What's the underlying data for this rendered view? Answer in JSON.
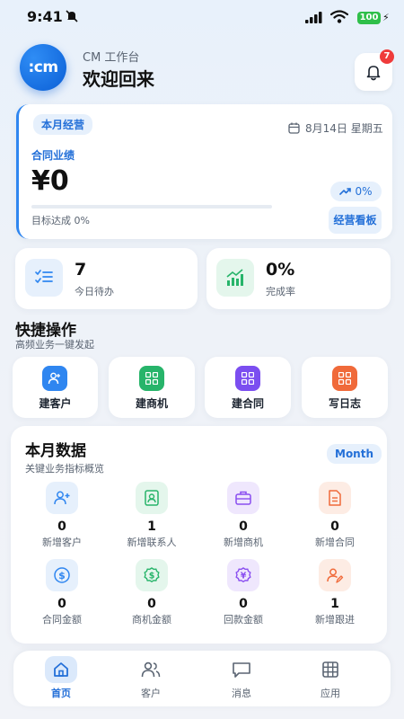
{
  "status_bar": {
    "time": "9:41",
    "battery": "100"
  },
  "header": {
    "logo_text": ":cm",
    "subtitle": "CM 工作台",
    "title": "欢迎回来",
    "notification_count": "7"
  },
  "overview": {
    "period_chip": "本月经营",
    "date": "8月14日 星期五",
    "metric_label": "合同业绩",
    "amount": "¥0",
    "target_text": "目标达成 0%",
    "progress_fraction": 0,
    "trend": "0%",
    "dashboard_button": "经营看板"
  },
  "stats": [
    {
      "value": "7",
      "label": "今日待办",
      "icon": "checklist-icon"
    },
    {
      "value": "0%",
      "label": "完成率",
      "icon": "growth-chart-icon"
    }
  ],
  "quick_actions": {
    "title": "快捷操作",
    "subtitle": "高频业务一键发起",
    "items": [
      {
        "label": "建客户",
        "icon": "add-customer-icon",
        "color": "#2f86f0"
      },
      {
        "label": "建商机",
        "icon": "grid-icon",
        "color": "#27b46a"
      },
      {
        "label": "建合同",
        "icon": "grid-icon",
        "color": "#7b4ef0"
      },
      {
        "label": "写日志",
        "icon": "grid-icon",
        "color": "#f06a3a"
      }
    ]
  },
  "monthly": {
    "title": "本月数据",
    "subtitle": "关键业务指标概览",
    "chip": "Month",
    "metrics": [
      {
        "value": "0",
        "label": "新增客户",
        "icon": "add-user-icon",
        "color": "#2f86f0"
      },
      {
        "value": "1",
        "label": "新增联系人",
        "icon": "contact-card-icon",
        "color": "#27b46a"
      },
      {
        "value": "0",
        "label": "新增商机",
        "icon": "briefcase-icon",
        "color": "#8a4ef0"
      },
      {
        "value": "0",
        "label": "新增合同",
        "icon": "document-icon",
        "color": "#f06a3a"
      },
      {
        "value": "0",
        "label": "合同金额",
        "icon": "dollar-icon",
        "color": "#2f86f0"
      },
      {
        "value": "0",
        "label": "商机金额",
        "icon": "dollar-icon",
        "color": "#27b46a"
      },
      {
        "value": "0",
        "label": "回款金额",
        "icon": "yen-icon",
        "color": "#8a4ef0"
      },
      {
        "value": "1",
        "label": "新增跟进",
        "icon": "follow-up-icon",
        "color": "#f06a3a"
      }
    ]
  },
  "nav": [
    {
      "label": "首页",
      "icon": "home-icon",
      "active": true
    },
    {
      "label": "客户",
      "icon": "users-icon",
      "active": false
    },
    {
      "label": "消息",
      "icon": "message-icon",
      "active": false
    },
    {
      "label": "应用",
      "icon": "apps-grid-icon",
      "active": false
    }
  ]
}
